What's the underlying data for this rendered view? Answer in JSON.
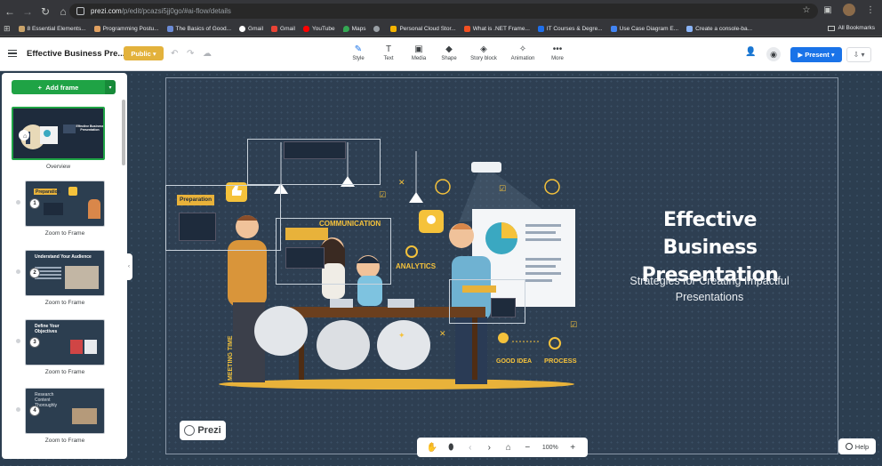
{
  "browser": {
    "url_domain": "prezi.com",
    "url_path": "/p/edit/pcazsi5jj0go/#ai-flow/details",
    "bookmarks": [
      {
        "label": "8 Essential Elements..."
      },
      {
        "label": "Programming Postu..."
      },
      {
        "label": "The Basics of Good..."
      },
      {
        "label": "Gmail"
      },
      {
        "label": "Gmail"
      },
      {
        "label": "YouTube"
      },
      {
        "label": "Maps"
      },
      {
        "label": ""
      },
      {
        "label": "Personal Cloud Stor..."
      },
      {
        "label": "What is .NET Frame..."
      },
      {
        "label": "IT Courses & Degre..."
      },
      {
        "label": "Use Case Diagram E..."
      },
      {
        "label": "Create a console-ba..."
      }
    ],
    "all_bookmarks": "All Bookmarks"
  },
  "toolbar": {
    "doc_title": "Effective Business Pre...",
    "public_label": "Public",
    "tools": [
      {
        "label": "Style",
        "icon": "brush-icon"
      },
      {
        "label": "Text",
        "icon": "text-icon"
      },
      {
        "label": "Media",
        "icon": "image-icon"
      },
      {
        "label": "Shape",
        "icon": "shape-icon"
      },
      {
        "label": "Story block",
        "icon": "layers-icon"
      },
      {
        "label": "Animation",
        "icon": "animation-icon"
      },
      {
        "label": "More",
        "icon": "more-icon"
      }
    ],
    "present_label": "Present"
  },
  "sidebar": {
    "add_frame_label": "Add frame",
    "overview_label": "Overview",
    "frames": [
      {
        "num": "1",
        "title": "Preparation",
        "label": "Zoom to Frame"
      },
      {
        "num": "2",
        "title": "Understand Your Audience",
        "label": "Zoom to Frame"
      },
      {
        "num": "3",
        "title": "Define Your Objectives",
        "label": "Zoom to Frame"
      },
      {
        "num": "4",
        "title": "Research Content Thoroughly",
        "label": "Zoom to Frame"
      }
    ]
  },
  "canvas": {
    "title": "Effective Business Presentation",
    "subtitle": "Strategies for Creating Impactful Presentations",
    "frame_label_preparation": "Preparation",
    "illus_words": [
      "COMMUNICATION",
      "ANALYTICS",
      "MEETING TIME",
      "GOOD IDEA",
      "PROCESS"
    ]
  },
  "prezi_brand": "Prezi",
  "zoom": {
    "value": "100%"
  },
  "help_label": "Help"
}
